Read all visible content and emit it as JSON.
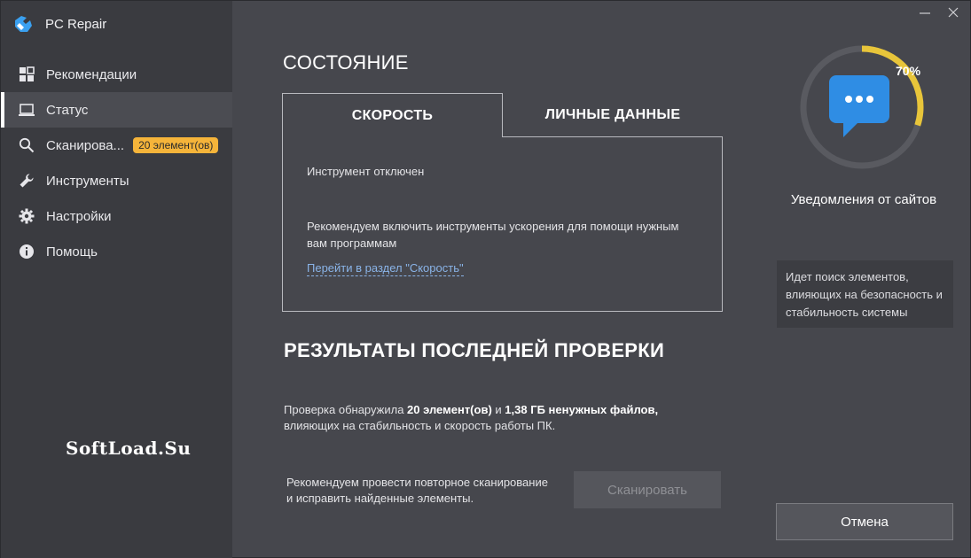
{
  "app": {
    "title": "PC Repair"
  },
  "sidebar": {
    "items": [
      {
        "label": "Рекомендации",
        "icon": "grid-icon"
      },
      {
        "label": "Статус",
        "icon": "monitor-icon",
        "active": true
      },
      {
        "label": "Сканирова...",
        "icon": "search-icon",
        "badge": "20 элемент(ов)"
      },
      {
        "label": "Инструменты",
        "icon": "wrench-icon"
      },
      {
        "label": "Настройки",
        "icon": "gear-icon"
      },
      {
        "label": "Помощь",
        "icon": "info-icon"
      }
    ],
    "watermark": "SoftLoad.Su"
  },
  "main": {
    "section_title": "СОСТОЯНИЕ",
    "tabs": [
      {
        "label": "СКОРОСТЬ",
        "active": true
      },
      {
        "label": "ЛИЧНЫЕ ДАННЫЕ",
        "active": false
      }
    ],
    "panel": {
      "status": "Инструмент отключен",
      "recommendation_line1": "Рекомендуем включить инструменты ускорения для помощи нужным",
      "recommendation_line2": "вам программам",
      "link": "Перейти в раздел \"Скорость\""
    },
    "results": {
      "title": "РЕЗУЛЬТАТЫ ПОСЛЕДНЕЙ ПРОВЕРКИ",
      "prefix": "Проверка обнаружила ",
      "count": "20 элемент(ов)",
      "mid": " и ",
      "size": "1,38 ГБ ненужных файлов,",
      "line2": "влияющих на стабильность и скорость работы ПК.",
      "rescan_line1": "Рекомендуем провести повторное сканирование",
      "rescan_line2": "и исправить найденные элементы.",
      "scan_button": "Сканировать"
    }
  },
  "right": {
    "progress_percent": 70,
    "progress_label": "70%",
    "caption": "Уведомления от сайтов",
    "info": "Идет поиск элементов, влияющих на безопасность и стабильность системы",
    "cancel_button": "Отмена"
  },
  "colors": {
    "accent_blue": "#2f8de4",
    "progress_yellow": "#e8c53a",
    "badge": "#f5b43a",
    "link": "#8ab4e8"
  }
}
